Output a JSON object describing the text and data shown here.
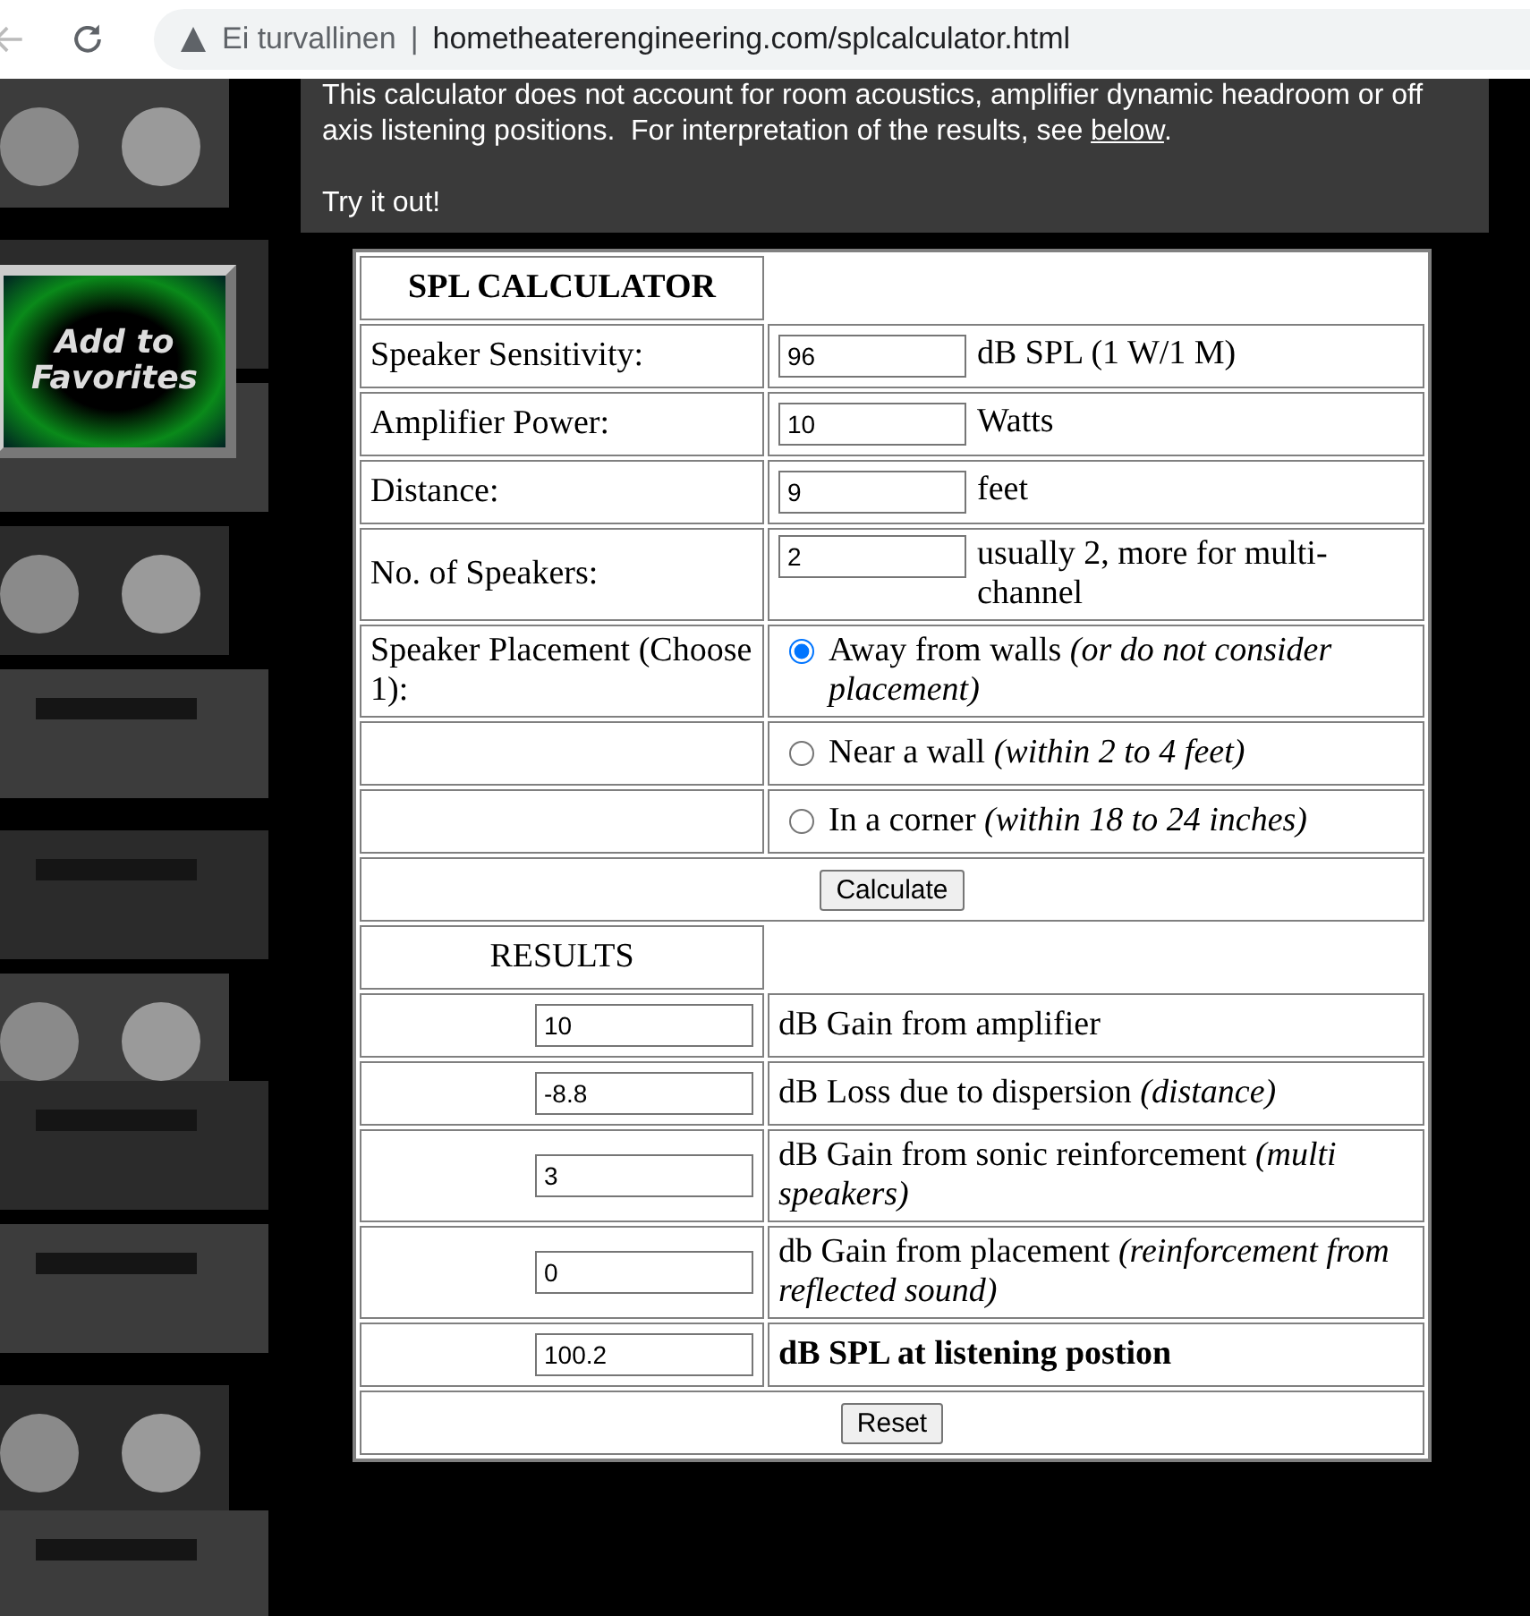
{
  "browser": {
    "security": "Ei turvallinen",
    "separator": "|",
    "url": "hometheaterengineering.com/splcalculator.html"
  },
  "sidebar": {
    "favorites_button": {
      "line_1": "Add to",
      "line_2": "Favorites"
    }
  },
  "intro": {
    "text": "This calculator does not account for room acoustics, amplifier dynamic headroom or off axis listening positions.  For interpretation of the results, see ",
    "link": "below",
    "after": ".",
    "prompt": "Try it out!"
  },
  "calculator": {
    "title": "SPL CALCULATOR",
    "inputs": [
      {
        "label": "Speaker Sensitivity:",
        "value": "96",
        "unit": "dB SPL (1 W/1 M)"
      },
      {
        "label": "Amplifier Power:",
        "value": "10",
        "unit": "Watts"
      },
      {
        "label": "Distance:",
        "value": "9",
        "unit": "feet"
      },
      {
        "label": "No. of Speakers:",
        "value": "2",
        "unit": "usually 2, more for multi-channel"
      }
    ],
    "placement": {
      "label": "Speaker Placement (Choose 1):",
      "options": [
        {
          "text": "Away from walls *(or do not consider placement)*",
          "selected": true
        },
        {
          "text": "Near a wall *(within 2 to 4 feet)*",
          "selected": false
        },
        {
          "text": "In a corner *(within 18 to 24 inches)*",
          "selected": false
        }
      ]
    },
    "calculate_button": "Calculate"
  },
  "results": {
    "title": "RESULTS",
    "rows": [
      {
        "value": "10",
        "text": "dB Gain from amplifier",
        "bold": false
      },
      {
        "value": "-8.8",
        "text": "dB Loss due to dispersion *(distance)*",
        "bold": false
      },
      {
        "value": "3",
        "text": "dB Gain from sonic reinforcement *(multi speakers)*",
        "bold": false
      },
      {
        "value": "0",
        "text": "db Gain from placement *(reinforcement from reflected sound)*",
        "bold": false
      },
      {
        "value": "100.2",
        "text": "dB SPL at listening postion",
        "bold": true
      }
    ],
    "reset_button": "Reset"
  }
}
